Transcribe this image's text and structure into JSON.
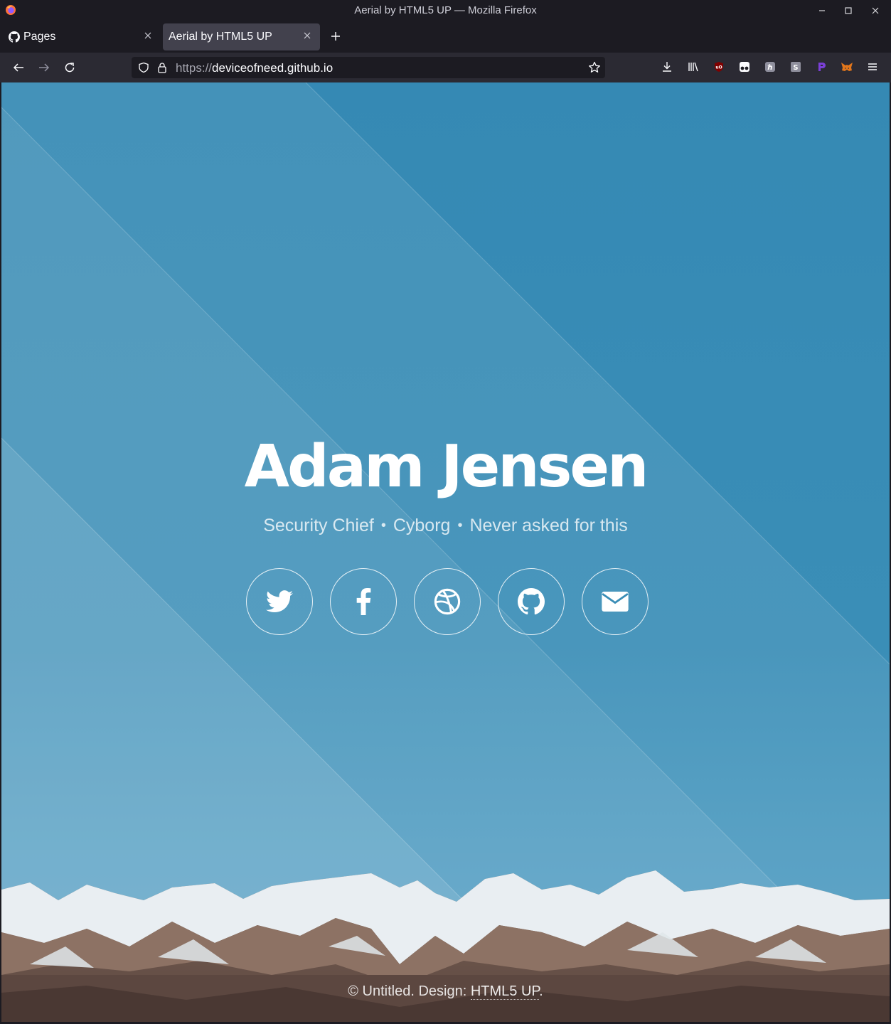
{
  "window": {
    "title": "Aerial by HTML5 UP — Mozilla Firefox"
  },
  "tabs": [
    {
      "label": "Pages",
      "icon": "github-icon",
      "active": false
    },
    {
      "label": "Aerial by HTML5 UP",
      "active": true
    }
  ],
  "urlbar": {
    "scheme": "https://",
    "host": "deviceofneed.github.io"
  },
  "toolbar_icons": [
    "download-icon",
    "library-icon",
    "ublock-icon",
    "tampermonkey-icon",
    "extension-h-icon",
    "extension-s-icon",
    "extension-p-icon",
    "metamask-icon",
    "menu-icon"
  ],
  "hero": {
    "name": "Adam Jensen",
    "tagline": [
      "Security Chief",
      "Cyborg",
      "Never asked for this"
    ],
    "social": [
      "twitter-icon",
      "facebook-icon",
      "dribbble-icon",
      "github-icon",
      "envelope-icon"
    ]
  },
  "footer": {
    "prefix": "© Untitled. Design: ",
    "link": "HTML5 UP",
    "suffix": "."
  },
  "colors": {
    "sky_top": "#3a8db6",
    "chrome_dark": "#1c1b22",
    "toolbar": "#2b2a33",
    "active_tab": "#42414d"
  }
}
